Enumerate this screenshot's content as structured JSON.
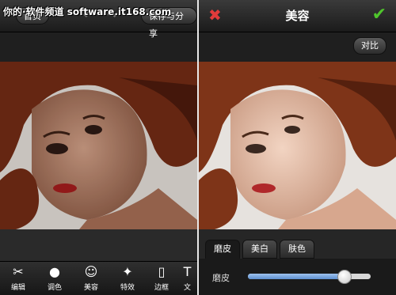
{
  "watermark": "你的·软件频道 software.it168.com",
  "left_screen": {
    "header": {
      "home_label": "首页",
      "save_share_label": "保存与分享"
    },
    "toolbar": {
      "items": [
        {
          "label": "编辑",
          "icon": "scissors-icon"
        },
        {
          "label": "调色",
          "icon": "palette-icon"
        },
        {
          "label": "美容",
          "icon": "face-icon"
        },
        {
          "label": "特效",
          "icon": "magic-wand-icon"
        },
        {
          "label": "边框",
          "icon": "frame-icon"
        },
        {
          "label": "文",
          "icon": "text-icon"
        }
      ]
    }
  },
  "right_screen": {
    "header": {
      "title": "美容",
      "cancel_icon": "close-icon",
      "confirm_icon": "check-icon"
    },
    "compare_label": "对比",
    "tabs": [
      {
        "label": "磨皮",
        "active": true
      },
      {
        "label": "美白",
        "active": false
      },
      {
        "label": "肤色",
        "active": false
      }
    ],
    "slider": {
      "label": "磨皮",
      "value_fraction": 0.78
    }
  },
  "colors": {
    "cancel": "#e23b3b",
    "confirm": "#4fc52c",
    "slider_fill": "#6f9fd8"
  }
}
